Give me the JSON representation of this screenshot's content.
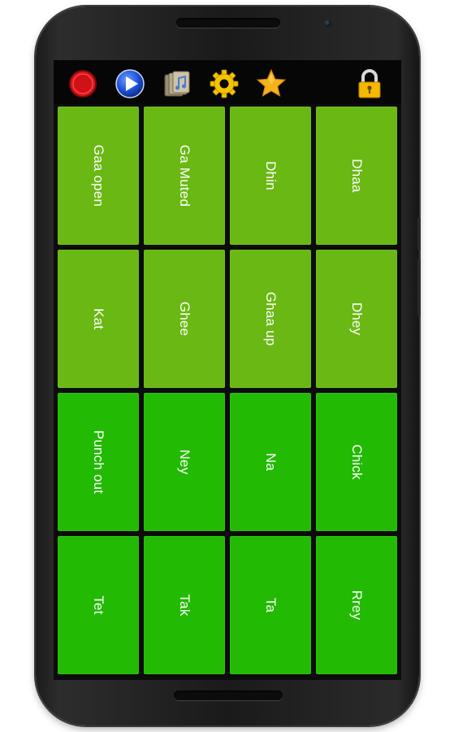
{
  "toolbar": {
    "icons": [
      {
        "name": "record-icon",
        "color": "#e0151b"
      },
      {
        "name": "play-icon",
        "color": "#1b4fd6"
      },
      {
        "name": "music-folder-icon",
        "color": "#8a7d63"
      },
      {
        "name": "gear-icon",
        "color": "#f5c400"
      },
      {
        "name": "star-icon",
        "color": "#f6b21a"
      },
      {
        "name": "lock-icon",
        "color": "#f5b800"
      }
    ]
  },
  "colors": {
    "pad_light": "#6ab814",
    "pad_dark": "#23ba03",
    "screen_bg": "#0c0c0c",
    "label": "#ffffff"
  },
  "pads": {
    "row1": [
      "Gaa open",
      "Ga Muted",
      "Dhin",
      "Dhaa"
    ],
    "row2": [
      "Kat",
      "Ghee",
      "Ghaa up",
      "Dhey"
    ],
    "row3": [
      "Punch out",
      "Ney",
      "Na",
      "Chick"
    ],
    "row4": [
      "Tet",
      "Tak",
      "Ta",
      "Rrey"
    ]
  }
}
